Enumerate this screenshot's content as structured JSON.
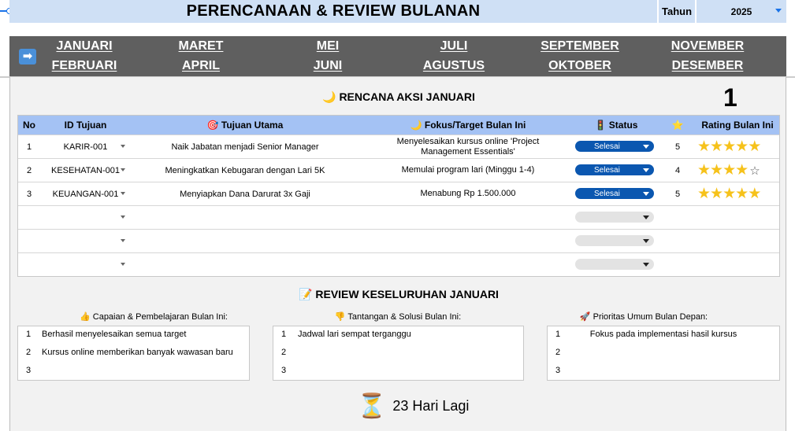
{
  "header": {
    "title": "PERENCANAAN & REVIEW BULANAN",
    "year_label": "Tahun",
    "year_value": "2025"
  },
  "nav": {
    "arrow_icon": "right-arrow-icon",
    "months_top": [
      "JANUARI",
      "MARET",
      "MEI",
      "JULI",
      "SEPTEMBER",
      "NOVEMBER"
    ],
    "months_bottom": [
      "FEBRUARI",
      "APRIL",
      "JUNI",
      "AGUSTUS",
      "OKTOBER",
      "DESEMBER"
    ]
  },
  "plan": {
    "title": "🌙 RENCANA AKSI JANUARI",
    "month_number": "1",
    "columns": {
      "no": "No",
      "id": "ID Tujuan",
      "goal": "🎯 Tujuan Utama",
      "focus": "🌙 Fokus/Target Bulan Ini",
      "status": "🚦 Status",
      "star": "⭐",
      "rating": "Rating Bulan Ini"
    },
    "rows": [
      {
        "no": "1",
        "id": "KARIR-001",
        "goal": "Naik Jabatan menjadi Senior Manager",
        "focus": "Menyelesaikan kursus online 'Project Management Essentials'",
        "status": "Selesai",
        "score": "5",
        "stars": 5
      },
      {
        "no": "2",
        "id": "KESEHATAN-001",
        "goal": "Meningkatkan Kebugaran dengan Lari 5K",
        "focus": "Memulai program lari (Minggu 1-4)",
        "status": "Selesai",
        "score": "4",
        "stars": 4
      },
      {
        "no": "3",
        "id": "KEUANGAN-001",
        "goal": "Menyiapkan Dana Darurat 3x Gaji",
        "focus": "Menabung Rp 1.500.000",
        "status": "Selesai",
        "score": "5",
        "stars": 5
      },
      {
        "no": "",
        "id": "",
        "goal": "",
        "focus": "",
        "status": "",
        "score": "",
        "stars": 0
      },
      {
        "no": "",
        "id": "",
        "goal": "",
        "focus": "",
        "status": "",
        "score": "",
        "stars": 0
      },
      {
        "no": "",
        "id": "",
        "goal": "",
        "focus": "",
        "status": "",
        "score": "",
        "stars": 0
      }
    ]
  },
  "review": {
    "title": "📝 REVIEW KESELURUHAN JANUARI",
    "sections": [
      {
        "heading": "👍 Capaian & Pembelajaran Bulan Ini:",
        "items": [
          {
            "n": "1",
            "text": "Berhasil menyelesaikan semua target"
          },
          {
            "n": "2",
            "text": "Kursus online memberikan banyak wawasan baru"
          },
          {
            "n": "3",
            "text": ""
          }
        ]
      },
      {
        "heading": "👎 Tantangan & Solusi Bulan Ini:",
        "items": [
          {
            "n": "1",
            "text": "Jadwal lari sempat terganggu"
          },
          {
            "n": "2",
            "text": ""
          },
          {
            "n": "3",
            "text": ""
          }
        ]
      },
      {
        "heading": "🚀 Prioritas Umum Bulan Depan:",
        "items": [
          {
            "n": "1",
            "text": "Fokus pada implementasi hasil kursus"
          },
          {
            "n": "2",
            "text": ""
          },
          {
            "n": "3",
            "text": ""
          }
        ]
      }
    ]
  },
  "countdown": {
    "icon": "hourglass-icon",
    "text": "23 Hari Lagi"
  },
  "colors": {
    "header_bg": "#cfe0f5",
    "nav_bg": "#5f5f5f",
    "table_head": "#a4c2f4",
    "status_done": "#0b57b0",
    "star": "#f6c21b"
  }
}
